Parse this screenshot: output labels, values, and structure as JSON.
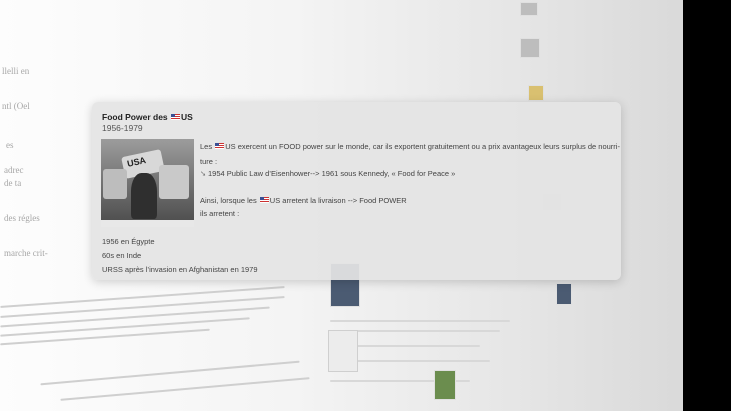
{
  "popup": {
    "title_prefix": "Food Power des ",
    "title_suffix": "US",
    "subtitle": "1956-1979",
    "para1_part1": "Les ",
    "para1_part2": "US  exercent un FOOD power sur le monde, car ils exportent gratuitement ou a prix avantageux leurs surplus de nourri-",
    "para1_line2": "ture :",
    "bullet_icon": "right-arrow-icon",
    "bullet_text": "1954 Public Law d’Eisenhower-->  1961 sous Kennedy, « Food for Peace »",
    "para2_part1": "Ainsi, lorsque les ",
    "para2_part2": "US arretent la livraison --> Food POWER",
    "para2_line2": "ils arretent :",
    "items": [
      "1956 en Égypte",
      "60s en Inde",
      "URSS après l’invasion en Afghanistan en 1979"
    ],
    "photo_label": "USA"
  },
  "colors": {
    "card_bg": "#e4e4e4",
    "flag_red": "#cc3333",
    "flag_blue": "#3a4f93"
  }
}
